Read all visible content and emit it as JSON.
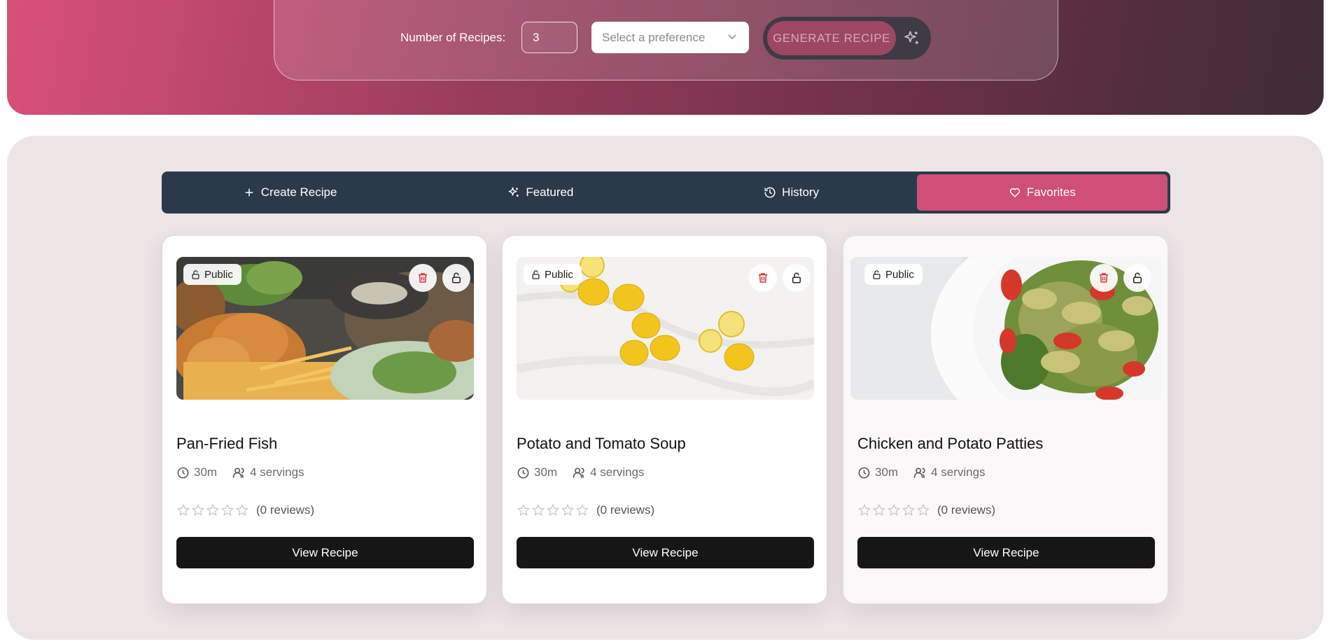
{
  "generator": {
    "num_recipes_label": "Number of Recipes:",
    "num_recipes_value": "3",
    "preference_placeholder": "Select a preference",
    "generate_label": "GENERATE RECIPE"
  },
  "tabs": [
    {
      "label": "Create Recipe",
      "icon": "plus-icon",
      "active": false
    },
    {
      "label": "Featured",
      "icon": "sparkles-icon",
      "active": false
    },
    {
      "label": "History",
      "icon": "history-icon",
      "active": false
    },
    {
      "label": "Favorites",
      "icon": "heart-icon",
      "active": true
    }
  ],
  "recipes": [
    {
      "title": "Pan-Fried Fish",
      "visibility": "Public",
      "time": "30m",
      "servings": "4 servings",
      "reviews": "(0 reviews)",
      "rating": 0,
      "view_label": "View Recipe",
      "image": "fried-fish-platter"
    },
    {
      "title": "Potato and Tomato Soup",
      "visibility": "Public",
      "time": "30m",
      "servings": "4 servings",
      "reviews": "(0 reviews)",
      "rating": 0,
      "view_label": "View Recipe",
      "image": "lemons-on-white"
    },
    {
      "title": "Chicken and Potato Patties",
      "visibility": "Public",
      "time": "30m",
      "servings": "4 servings",
      "reviews": "(0 reviews)",
      "rating": 0,
      "view_label": "View Recipe",
      "image": "pesto-pasta-bowl"
    }
  ],
  "colors": {
    "accent": "#d04f78",
    "tab_bar": "#2b3a4a",
    "button_dark": "#161616",
    "delete_red": "#e0323c"
  }
}
